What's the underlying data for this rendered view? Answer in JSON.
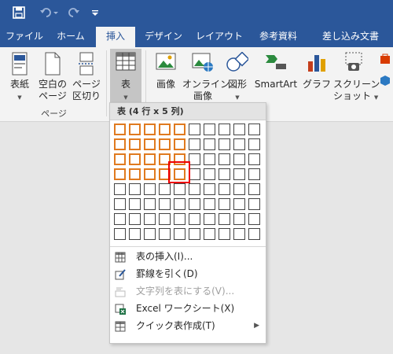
{
  "quick_access": {
    "save_icon": "save-icon",
    "undo_icon": "undo-icon",
    "redo_icon": "redo-icon",
    "customize_icon": "customize-qat-icon"
  },
  "tabs": [
    "ファイル",
    "ホーム",
    "挿入",
    "デザイン",
    "レイアウト",
    "参考資料",
    "差し込み文書"
  ],
  "active_tab": "挿入",
  "ribbon": {
    "pages_group": {
      "label": "ページ",
      "cover": "表紙",
      "blank_l1": "空白の",
      "blank_l2": "ページ",
      "break_l1": "ページ",
      "break_l2": "区切り"
    },
    "table": "表",
    "picture": "画像",
    "online_l1": "オンライン",
    "online_l2": "画像",
    "shapes": "図形",
    "smartart": "SmartArt",
    "graph": "グラフ",
    "screenshot_l1": "スクリーン",
    "screenshot_l2": "ショット"
  },
  "dropdown": {
    "header": "表 (4 行 x 5 列)",
    "grid_cols": 10,
    "grid_rows": 8,
    "selected_cols": 5,
    "selected_rows": 4,
    "items": [
      {
        "label": "表の挿入(I)...",
        "icon": "insert-table-icon",
        "disabled": false
      },
      {
        "label": "罫線を引く(D)",
        "icon": "draw-table-icon",
        "disabled": false
      },
      {
        "label": "文字列を表にする(V)...",
        "icon": "convert-text-to-table-icon",
        "disabled": true
      },
      {
        "label": "Excel ワークシート(X)",
        "icon": "excel-icon",
        "disabled": false
      },
      {
        "label": "クイック表作成(T)",
        "icon": "quick-tables-icon",
        "disabled": false
      }
    ]
  },
  "colors": {
    "title_bar": "#2b579a",
    "selection": "#e07a1f",
    "highlight": "#ee0000"
  }
}
